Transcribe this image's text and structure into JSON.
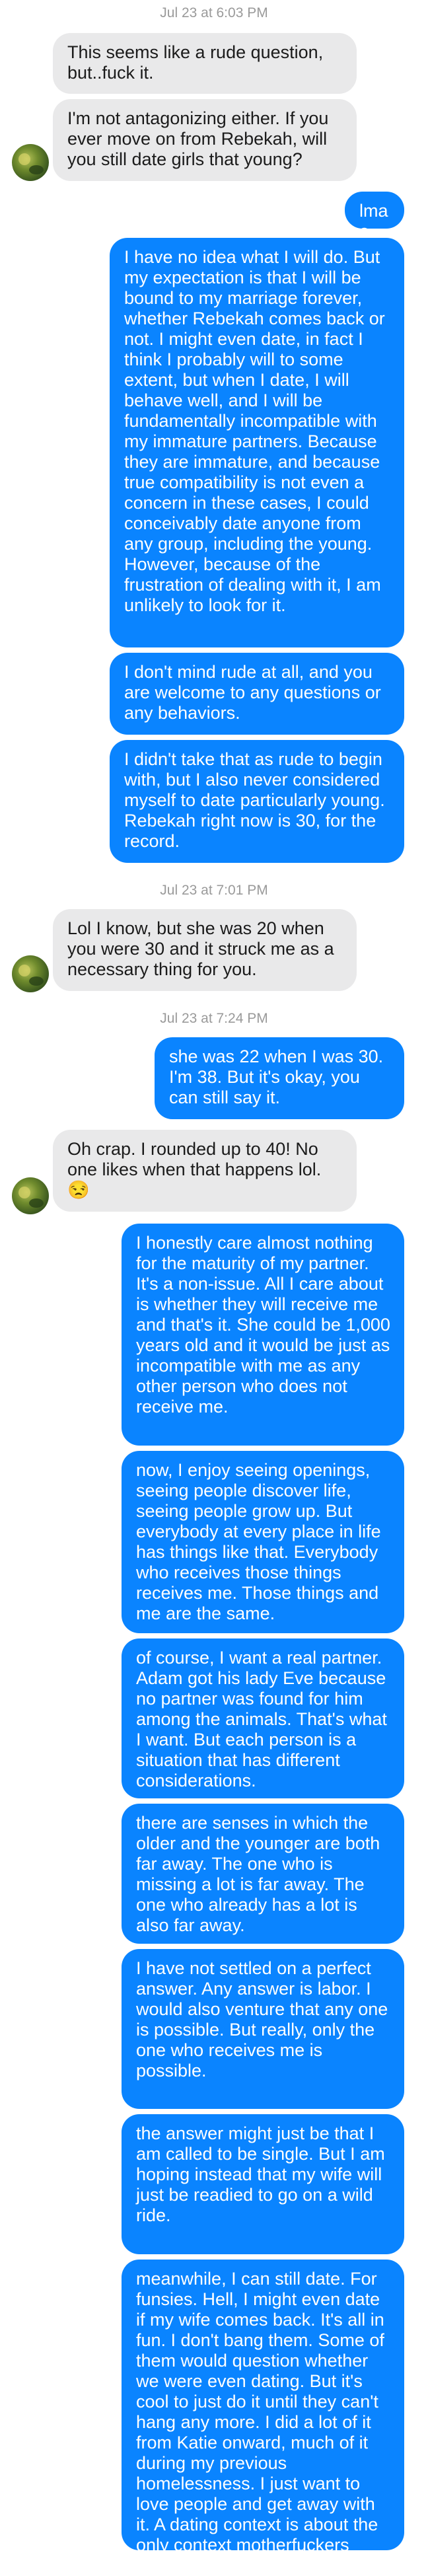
{
  "thread": {
    "timestamps": [
      "Jul 23 at 6:03 PM",
      "Jul 23 at 7:01 PM",
      "Jul 23 at 7:24 PM"
    ],
    "messages": [
      {
        "from": "them",
        "text": "This seems like a rude question, but..fuck it."
      },
      {
        "from": "them",
        "text": "I'm not antagonizing either. If you ever move on from Rebekah, will you still date girls that young?"
      },
      {
        "from": "me",
        "text": "lmao."
      },
      {
        "from": "me",
        "text": "I have no idea what I will do. But my expectation is that I will be bound to my marriage forever, whether Rebekah comes back or not. I might even date, in fact I think I probably will to some extent, but when I date, I will behave well, and I will be fundamentally incompatible with my immature partners. Because they are immature, and because true compatibility is not even a concern in these cases, I could conceivably date anyone from any group, including the young. However, because of the frustration of dealing with it, I am unlikely to look for it."
      },
      {
        "from": "me",
        "text": "I don't mind rude at all, and you are welcome to any questions or any behaviors."
      },
      {
        "from": "me",
        "text": "I didn't take that as rude to begin with, but I also never considered myself to date particularly young. Rebekah right now is 30, for the record."
      },
      {
        "from": "them",
        "text": "Lol I know, but she was 20 when you were 30 and it struck me as a necessary thing for you."
      },
      {
        "from": "me",
        "text": "she was 22 when I was 30. I'm 38. But it's okay, you can still say it."
      },
      {
        "from": "them",
        "text": "Oh crap. I rounded up to 40! No one likes when that happens lol."
      },
      {
        "from": "me",
        "text": "I honestly care almost nothing for the maturity of my partner. It's a non-issue. All I care about is whether they will receive me and that's it. She could be 1,000 years old and it would be just as incompatible with me as any other person who does not receive me."
      },
      {
        "from": "me",
        "text": "now, I enjoy seeing openings, seeing people discover life, seeing people grow up. But everybody at every place in life has things like that. Everybody who receives those things receives me. Those things and me are the same."
      },
      {
        "from": "me",
        "text": "of course, I want a real partner. Adam got his lady Eve because no partner was found for him among the animals. That's what I want. But each person is a situation that has different considerations."
      },
      {
        "from": "me",
        "text": "there are senses in which the older and the younger are both far away. The one who is missing a lot is far away. The one who already has a lot is also far away."
      },
      {
        "from": "me",
        "text": "I have not settled on a perfect answer. Any answer is labor. I would also venture that any one is possible. But really, only the one who receives me is possible."
      },
      {
        "from": "me",
        "text": "the answer might just be that I am called to be single. But I am hoping instead that my wife will just be readied to go on a wild ride."
      },
      {
        "from": "me",
        "text": "meanwhile, I can still date. For funsies. Hell, I might even date if my wife comes back. It's all in fun. I don't bang them. Some of them would question whether we were even dating. But it's cool to just do it until they can't hang any more. I did a lot of it from Katie onward, much of it during my previous homelessness. I just want to love people and get away with it. A dating context is about the only context motherfuckers even understand."
      }
    ],
    "emoji": {
      "unamused": "😒"
    },
    "colors": {
      "outgoing": "#0a84ff",
      "incoming": "#e9e9ea",
      "timestamp": "#9a9a9a"
    }
  }
}
